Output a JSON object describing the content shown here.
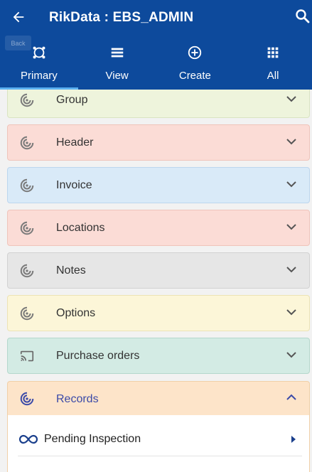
{
  "header": {
    "title": "RikData : EBS_ADMIN",
    "back_tooltip": "Back",
    "bg_color": "#0d4a9c"
  },
  "tabs": [
    {
      "label": "Primary",
      "icon": "primary-ring-icon",
      "active": true
    },
    {
      "label": "View",
      "icon": "list-icon",
      "active": false
    },
    {
      "label": "Create",
      "icon": "add-circle-icon",
      "active": false
    },
    {
      "label": "All",
      "icon": "grid-icon",
      "active": false
    }
  ],
  "sections": [
    {
      "label": "Group",
      "icon": "target-icon",
      "color": "#eef4dc"
    },
    {
      "label": "Header",
      "icon": "target-icon",
      "color": "#fbdcd6"
    },
    {
      "label": "Invoice",
      "icon": "target-icon",
      "color": "#d9eaf8"
    },
    {
      "label": "Locations",
      "icon": "target-icon",
      "color": "#fbdcd6"
    },
    {
      "label": "Notes",
      "icon": "target-icon",
      "color": "#e6e6e6"
    },
    {
      "label": "Options",
      "icon": "target-icon",
      "color": "#fcf6d8"
    },
    {
      "label": "Purchase orders",
      "icon": "cast-icon",
      "color": "#d3ebe4"
    }
  ],
  "expanded_section": {
    "label": "Records",
    "icon": "target-icon",
    "color": "#fde4c9",
    "items": [
      {
        "label": "Pending Inspection",
        "icon": "infinity-icon"
      }
    ]
  }
}
